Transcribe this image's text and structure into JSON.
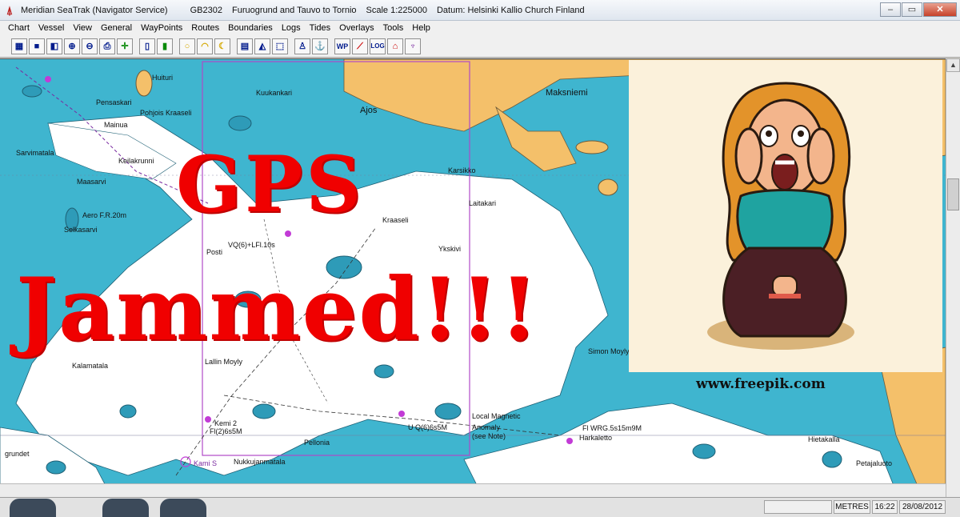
{
  "titlebar": {
    "app_name": "Meridian SeaTrak (Navigator Service)",
    "chart_id": "GB2302",
    "chart_name": "Furuogrund and Tauvo to Tornio",
    "scale": "Scale 1:225000",
    "datum": "Datum: Helsinki Kallio Church Finland"
  },
  "menu": [
    "Chart",
    "Vessel",
    "View",
    "General",
    "WayPoints",
    "Routes",
    "Boundaries",
    "Logs",
    "Tides",
    "Overlays",
    "Tools",
    "Help"
  ],
  "toolbar": {
    "icons": [
      "chart-icon",
      "vessel-icon",
      "windows-icon",
      "zoom-in-icon",
      "zoom-out-icon",
      "print-icon",
      "crosshair-icon",
      "panel-left-icon",
      "panel-right-icon",
      "circle-icon",
      "arc-icon",
      "moon-icon",
      "grid-icon",
      "depth-icon",
      "select-icon",
      "person-icon",
      "anchor-icon",
      "wp-icon",
      "route-icon",
      "log-icon",
      "home-icon",
      "tide-icon"
    ],
    "wp_label": "WP",
    "log_label": "LOG"
  },
  "overlay": {
    "line1": "GPS",
    "line2": "Jammed!!!",
    "credit": "www.freepik.com"
  },
  "map_labels": [
    "Maksniemi",
    "Ajos",
    "Kuukankari",
    "Pensaskari",
    "Mainua",
    "Pohjois Kraaseli",
    "Sarvimatala",
    "Maasarvi",
    "Aero F.R.20m",
    "Selkasarvi",
    "Keilakrunni",
    "Karsikko",
    "Laitakari",
    "Kraaseli",
    "Ykskivi",
    "Lallin Moyly",
    "Kalamatala",
    "Kemi 2",
    "Fl(2)6s5M",
    "Pellonia",
    "Nukkujanmatala",
    "Local Magnetic",
    "Anomaly",
    "(see Note)",
    "U Q(6)6s5M",
    "Fl WRG.5s15m9M",
    "Harkaletto",
    "Hietakalla",
    "Petajaluoto",
    "Simon Moyly",
    "VQ(6)+LFl.10s",
    "Kami S",
    "grundet",
    "Posti",
    "Huituri"
  ],
  "statusbar": {
    "units": "METRES",
    "time": "16:22",
    "date": "28/08/2012"
  }
}
